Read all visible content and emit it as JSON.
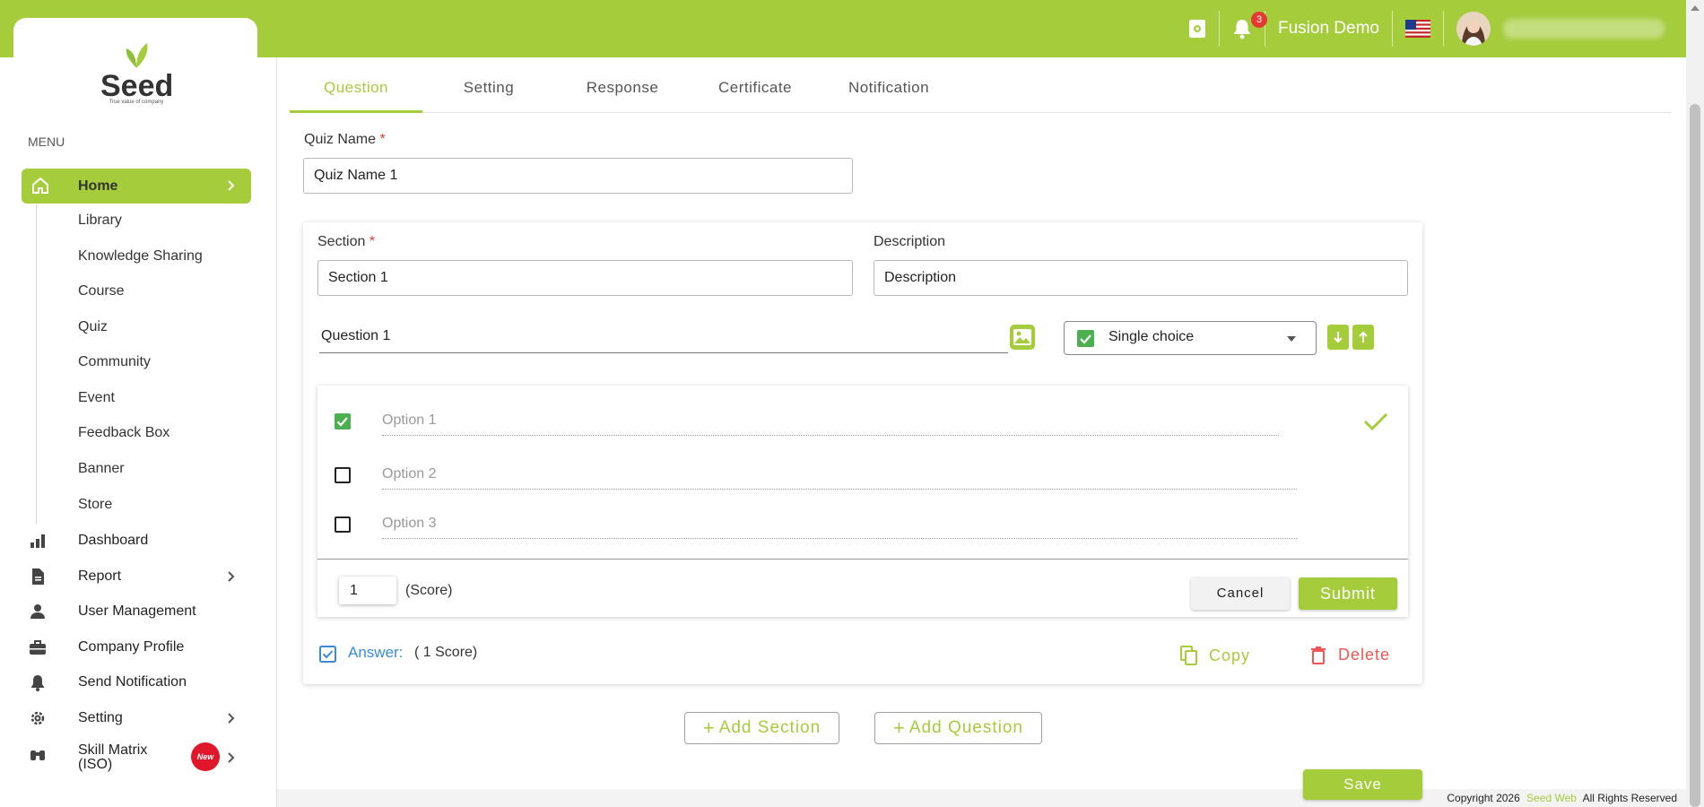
{
  "colors": {
    "brand": "#a4cc3b",
    "danger": "#f25555",
    "link": "#3b8ad6",
    "check": "#4caf50"
  },
  "topbar": {
    "user_name": "Fusion Demo",
    "notification_count": "3"
  },
  "logo": {
    "name": "Seed",
    "tagline": "True value of company"
  },
  "sidebar": {
    "menu_title": "MENU",
    "home_label": "Home",
    "sub_items": [
      "Library",
      "Knowledge Sharing",
      "Course",
      "Quiz",
      "Community",
      "Event",
      "Feedback Box",
      "Banner",
      "Store"
    ],
    "items": [
      {
        "label": "Dashboard",
        "icon": "bar-chart-icon"
      },
      {
        "label": "Report",
        "icon": "document-icon"
      },
      {
        "label": "User Management",
        "icon": "user-icon"
      },
      {
        "label": "Company Profile",
        "icon": "briefcase-icon"
      },
      {
        "label": "Send Notification",
        "icon": "bell-ring-icon"
      },
      {
        "label": "Setting",
        "icon": "gear-icon"
      },
      {
        "label": "Skill Matrix (ISO)",
        "icon": "binoculars-icon",
        "badge": "New"
      }
    ]
  },
  "tabs": [
    "Question",
    "Setting",
    "Response",
    "Certificate",
    "Notification"
  ],
  "form": {
    "quiz_name_label": "Quiz Name",
    "quiz_name_value": "Quiz Name 1",
    "section_label": "Section",
    "section_value": "Section 1",
    "description_label": "Description",
    "description_value": "Description",
    "required_mark": "*"
  },
  "question": {
    "title": "Question 1",
    "type": "Single choice",
    "options": [
      {
        "label": "Option 1",
        "checked": true
      },
      {
        "label": "Option 2",
        "checked": false
      },
      {
        "label": "Option 3",
        "checked": false
      }
    ],
    "score_value": "1",
    "score_label": "(Score)",
    "cancel_label": "Cancel",
    "submit_label": "Submit",
    "answer_label": "Answer:",
    "answer_score": "( 1 Score)",
    "copy_label": "Copy",
    "delete_label": "Delete"
  },
  "actions": {
    "add_section": "Add Section",
    "add_question": "Add Question",
    "save": "Save"
  },
  "footer": {
    "prefix": "Copyright 2026",
    "brand": "Seed Web",
    "suffix": "All Rights Reserved"
  }
}
